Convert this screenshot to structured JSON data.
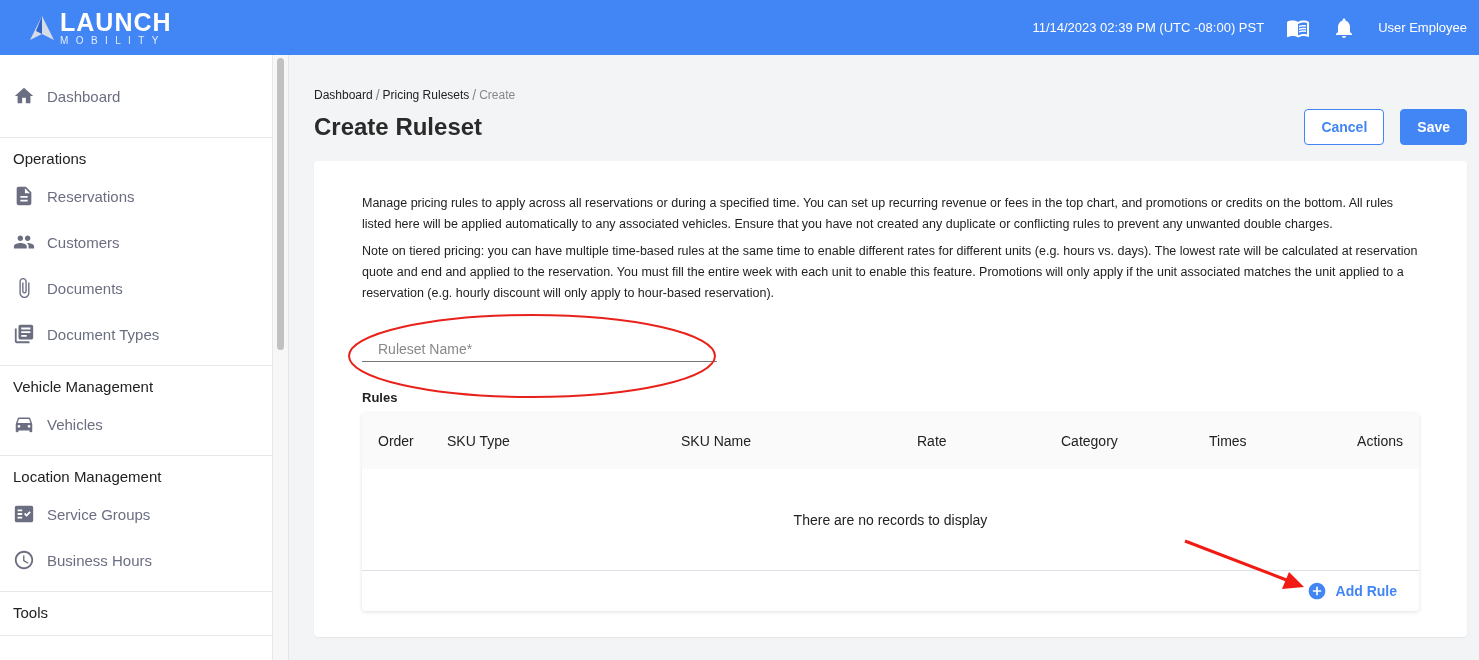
{
  "header": {
    "logo_title": "LAUNCH",
    "logo_subtitle": "MOBILITY",
    "datetime": "11/14/2023 02:39 PM (UTC -08:00) PST",
    "user": "User Employee"
  },
  "sidebar": {
    "sections": [
      {
        "items": [
          {
            "label": "Dashboard"
          }
        ]
      },
      {
        "title": "Operations",
        "items": [
          {
            "label": "Reservations"
          },
          {
            "label": "Customers"
          },
          {
            "label": "Documents"
          },
          {
            "label": "Document Types"
          }
        ]
      },
      {
        "title": "Vehicle Management",
        "items": [
          {
            "label": "Vehicles"
          }
        ]
      },
      {
        "title": "Location Management",
        "items": [
          {
            "label": "Service Groups"
          },
          {
            "label": "Business Hours"
          }
        ]
      },
      {
        "title": "Tools"
      }
    ]
  },
  "breadcrumb": [
    {
      "label": "Dashboard",
      "current": false
    },
    {
      "separator": "/",
      "label": "Pricing Rulesets",
      "current": false
    },
    {
      "separator": "/",
      "label": "Create",
      "current": true
    }
  ],
  "page_title": "Create Ruleset",
  "buttons": {
    "cancel": "Cancel",
    "save": "Save"
  },
  "description": [
    "Manage pricing rules to apply across all reservations or during a specified time. You can set up recurring revenue or fees in the top chart, and promotions or credits on the bottom. All rules listed here will be applied automatically to any associated vehicles. Ensure that you have not created any duplicate or conflicting rules to prevent any unwanted double charges.",
    "Note on tiered pricing: you can have multiple time-based rules at the same time to enable different rates for different units (e.g. hours vs. days). The lowest rate will be calculated at reservation quote and end and applied to the reservation. You must fill the entire week with each unit to enable this feature. Promotions will only apply if the unit associated matches the unit applied to a reservation (e.g. hourly discount will only apply to hour-based reservation)."
  ],
  "ruleset_name": {
    "placeholder": "Ruleset Name*"
  },
  "rules": {
    "title": "Rules",
    "columns": [
      "Order",
      "SKU Type",
      "SKU Name",
      "Rate",
      "Category",
      "Times",
      "Actions"
    ],
    "empty_message": "There are no records to display",
    "add_button": "Add Rule"
  }
}
